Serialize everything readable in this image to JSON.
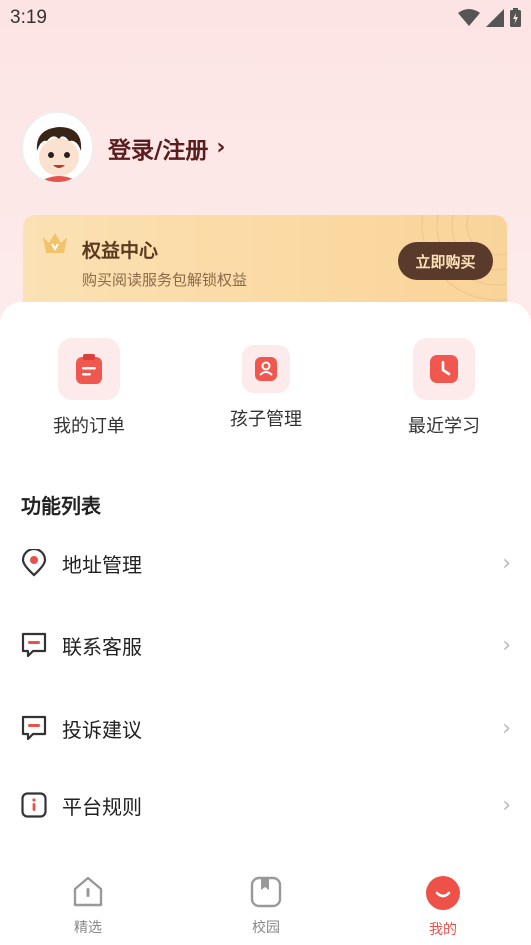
{
  "status_bar": {
    "time": "3:19",
    "icons": [
      "wifi-icon",
      "signal-icon",
      "battery-icon"
    ]
  },
  "profile": {
    "login_label": "登录/注册",
    "chevron": "›"
  },
  "vip": {
    "title": "权益中心",
    "subtitle": "购买阅读服务包解锁权益",
    "button": "立即购买"
  },
  "quick_actions": [
    {
      "label": "我的订单",
      "icon": "clipboard-icon"
    },
    {
      "label": "孩子管理",
      "icon": "badge-icon"
    },
    {
      "label": "最近学习",
      "icon": "clock-icon"
    }
  ],
  "function_list": {
    "title": "功能列表",
    "items": [
      {
        "label": "地址管理",
        "icon": "location-pin-icon"
      },
      {
        "label": "联系客服",
        "icon": "chat-minus-icon"
      },
      {
        "label": "投诉建议",
        "icon": "chat-minus-icon"
      },
      {
        "label": "平台规则",
        "icon": "info-icon"
      }
    ]
  },
  "tabbar": [
    {
      "label": "精选",
      "icon": "home-icon",
      "active": false
    },
    {
      "label": "校园",
      "icon": "book-icon",
      "active": false
    },
    {
      "label": "我的",
      "icon": "smile-icon",
      "active": true
    }
  ],
  "colors": {
    "accent": "#e8524a",
    "brand_dark": "#5a1c1c",
    "vip_button": "#5a3a2a"
  }
}
